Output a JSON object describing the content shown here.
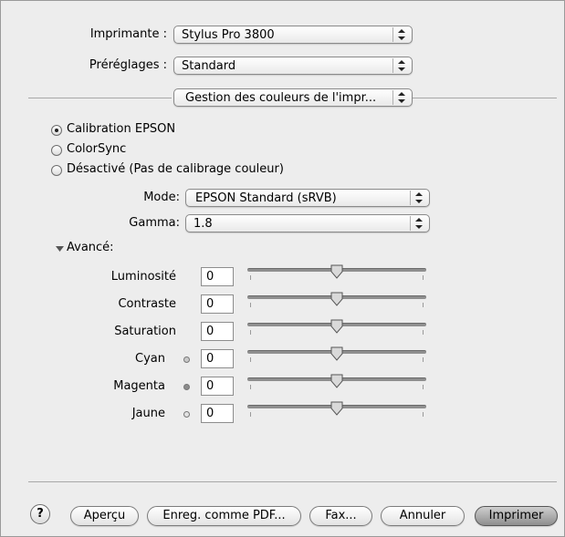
{
  "printer": {
    "label": "Imprimante :",
    "value": "Stylus Pro 3800"
  },
  "presets": {
    "label": "Préréglages :",
    "value": "Standard"
  },
  "panel": {
    "value": "Gestion des couleurs de l'impr..."
  },
  "color_mode": {
    "options": [
      {
        "label": "Calibration EPSON",
        "selected": true
      },
      {
        "label": "ColorSync",
        "selected": false
      },
      {
        "label": "Désactivé (Pas de calibrage couleur)",
        "selected": false
      }
    ]
  },
  "mode": {
    "label": "Mode:",
    "value": "EPSON Standard (sRVB)"
  },
  "gamma": {
    "label": "Gamma:",
    "value": "1.8"
  },
  "advanced": {
    "label": "Avancé:",
    "expanded": true
  },
  "adjustments": [
    {
      "label": "Luminosité",
      "value": "0",
      "slider_fraction": 0.5,
      "dot_color": ""
    },
    {
      "label": "Contraste",
      "value": "0",
      "slider_fraction": 0.5,
      "dot_color": ""
    },
    {
      "label": "Saturation",
      "value": "0",
      "slider_fraction": 0.5,
      "dot_color": ""
    },
    {
      "label": "Cyan",
      "value": "0",
      "slider_fraction": 0.5,
      "dot_color": "#c9c9c9"
    },
    {
      "label": "Magenta",
      "value": "0",
      "slider_fraction": 0.5,
      "dot_color": "#8c8c8c"
    },
    {
      "label": "Jaune",
      "value": "0",
      "slider_fraction": 0.5,
      "dot_color": "#e2e2e2"
    }
  ],
  "buttons": {
    "help": "?",
    "preview": "Aperçu",
    "save_pdf": "Enreg. comme PDF...",
    "fax": "Fax...",
    "cancel": "Annuler",
    "print": "Imprimer"
  }
}
